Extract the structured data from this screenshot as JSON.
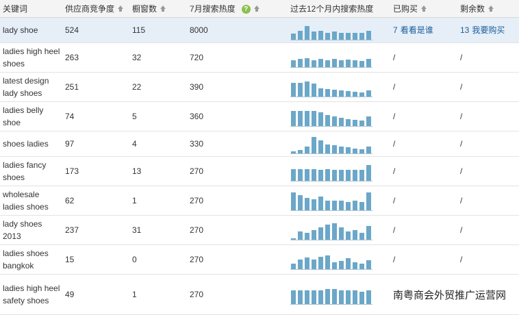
{
  "columns": {
    "keyword": "关键词",
    "suppliers": "供应商竞争度",
    "windows": "橱窗数",
    "search_hot": "7月搜索热度",
    "trend": "过去12个月内搜索热度",
    "bought": "已购买",
    "remaining": "剩余数"
  },
  "rows": [
    {
      "keyword": "lady shoe",
      "suppliers": "524",
      "windows": "115",
      "hot": "8000",
      "trend": [
        9,
        13,
        20,
        12,
        13,
        10,
        12,
        10,
        10,
        10,
        10,
        13
      ],
      "bought_num": "7",
      "bought_link": "看看是谁",
      "remaining_num": "13",
      "remaining_link": "我要购买"
    },
    {
      "keyword": "ladies high heel shoes",
      "suppliers": "263",
      "windows": "32",
      "hot": "720",
      "trend": [
        10,
        12,
        13,
        10,
        12,
        10,
        12,
        10,
        11,
        10,
        9,
        12
      ],
      "bought": "/",
      "remaining": "/"
    },
    {
      "keyword": "latest design lady shoes",
      "suppliers": "251",
      "windows": "22",
      "hot": "390",
      "trend": [
        20,
        20,
        22,
        19,
        12,
        11,
        10,
        9,
        8,
        7,
        6,
        9
      ],
      "bought": "/",
      "remaining": "/"
    },
    {
      "keyword": "ladies belly shoe",
      "suppliers": "74",
      "windows": "5",
      "hot": "360",
      "trend": [
        22,
        22,
        22,
        22,
        20,
        16,
        14,
        12,
        10,
        9,
        8,
        14
      ],
      "bought": "/",
      "remaining": "/"
    },
    {
      "keyword": "shoes ladies",
      "suppliers": "97",
      "windows": "4",
      "hot": "330",
      "trend": [
        3,
        5,
        10,
        24,
        19,
        13,
        12,
        10,
        9,
        7,
        6,
        10
      ],
      "bought": "/",
      "remaining": "/"
    },
    {
      "keyword": "ladies fancy shoes",
      "suppliers": "173",
      "windows": "13",
      "hot": "270",
      "trend": [
        17,
        17,
        17,
        17,
        16,
        17,
        16,
        16,
        16,
        16,
        16,
        23
      ],
      "bought": "/",
      "remaining": "/"
    },
    {
      "keyword": "wholesale ladies shoes",
      "suppliers": "62",
      "windows": "1",
      "hot": "270",
      "trend": [
        26,
        22,
        18,
        16,
        20,
        14,
        14,
        14,
        12,
        14,
        12,
        26
      ],
      "bought": "/",
      "remaining": "/"
    },
    {
      "keyword": "lady shoes 2013",
      "suppliers": "237",
      "windows": "31",
      "hot": "270",
      "trend": [
        2,
        12,
        10,
        14,
        18,
        22,
        24,
        18,
        12,
        14,
        10,
        20
      ],
      "bought": "/",
      "remaining": "/"
    },
    {
      "keyword": "ladies shoes bangkok",
      "suppliers": "15",
      "windows": "0",
      "hot": "270",
      "trend": [
        8,
        14,
        17,
        14,
        18,
        20,
        10,
        12,
        16,
        10,
        8,
        13
      ],
      "bought": "/",
      "remaining": "/"
    },
    {
      "keyword": "ladies high heel safety shoes",
      "suppliers": "49",
      "windows": "1",
      "hot": "270",
      "trend": [
        20,
        20,
        20,
        20,
        20,
        22,
        22,
        20,
        20,
        20,
        18,
        20
      ],
      "bought": "",
      "remaining": ""
    }
  ],
  "watermark": "南粤商会外贸推广运营网",
  "colors": {
    "bar": "#6ba7c8",
    "highlight_row": "#e6eff8",
    "link": "#1a5b99",
    "help_icon": "#8cbf4f"
  },
  "icons": {
    "sort": "sort-up-icon",
    "help": "help-question-icon"
  }
}
